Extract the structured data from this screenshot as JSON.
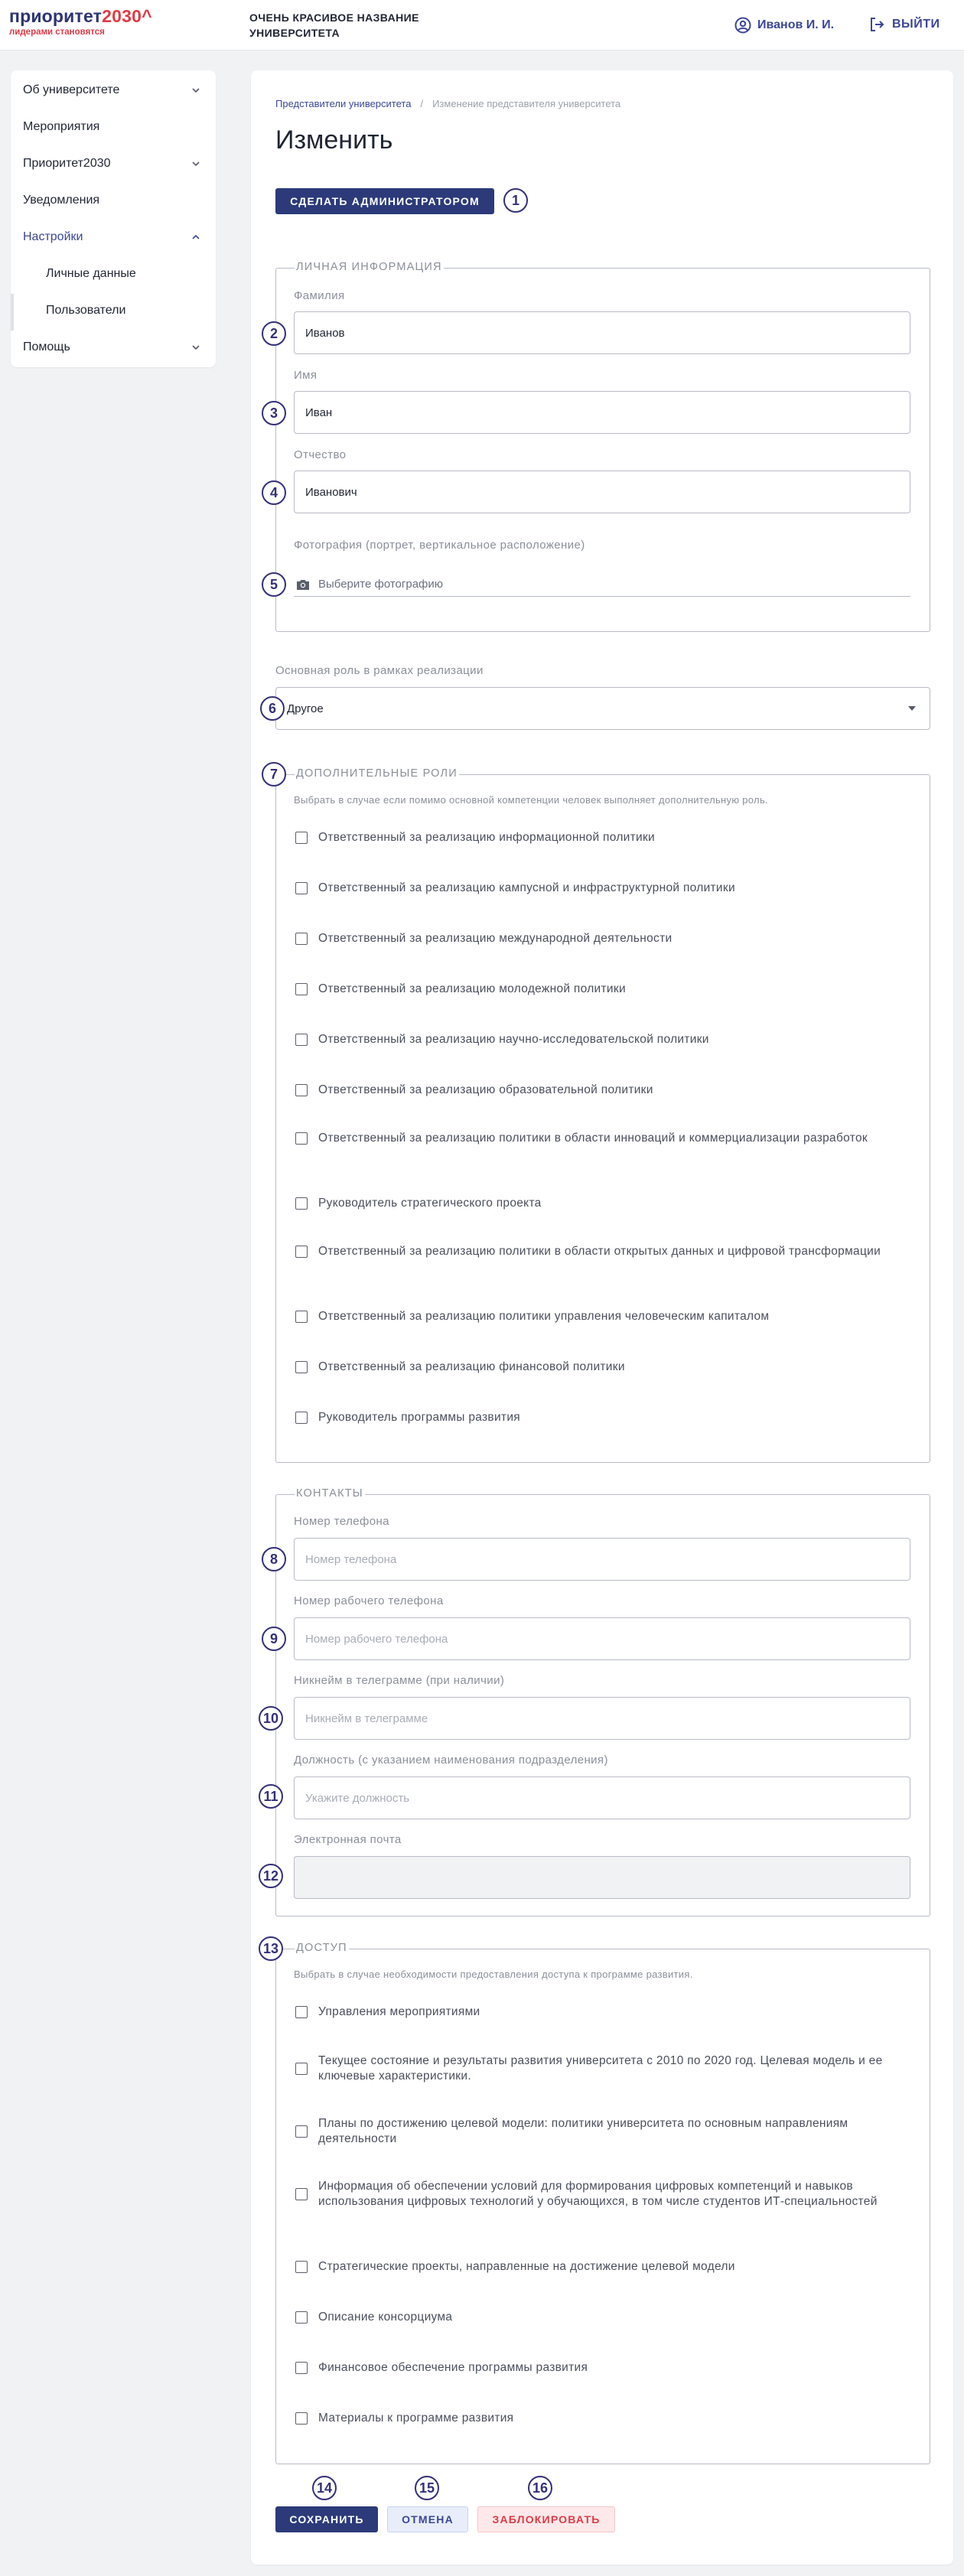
{
  "header": {
    "logo_main": "приоритет",
    "logo_accent": "2030^",
    "logo_sub": "лидерами становятся",
    "university_name": "ОЧЕНЬ КРАСИВОЕ НАЗВАНИЕ УНИВЕРСИТЕТА",
    "user_name": "Иванов И. И.",
    "logout_label": "ВЫЙТИ"
  },
  "sidebar": {
    "items": [
      {
        "label": "Об университете"
      },
      {
        "label": "Мероприятия"
      },
      {
        "label": "Приоритет2030"
      },
      {
        "label": "Уведомления"
      },
      {
        "label": "Настройки"
      },
      {
        "label": "Личные данные"
      },
      {
        "label": "Пользователи"
      },
      {
        "label": "Помощь"
      }
    ]
  },
  "breadcrumb": {
    "parent": "Представители университета",
    "separator": "/",
    "current": "Изменение представителя университета"
  },
  "page_title": "Изменить",
  "make_admin_label": "СДЕЛАТЬ АДМИНИСТРАТОРОМ",
  "markers": [
    "1",
    "2",
    "3",
    "4",
    "5",
    "6",
    "7",
    "8",
    "9",
    "10",
    "11",
    "12",
    "13",
    "14",
    "15",
    "16"
  ],
  "personal": {
    "legend": "ЛИЧНАЯ ИНФОРМАЦИЯ",
    "last_name_label": "Фамилия",
    "last_name_value": "Иванов",
    "first_name_label": "Имя",
    "first_name_value": "Иван",
    "middle_name_label": "Отчество",
    "middle_name_value": "Иванович",
    "photo_label": "Фотография (портрет, вертикальное расположение)",
    "photo_placeholder": "Выберите фотографию"
  },
  "role": {
    "label": "Основная роль в рамках реализации",
    "value": "Другое"
  },
  "additional_roles": {
    "legend": "ДОПОЛНИТЕЛЬНЫЕ РОЛИ",
    "description": "Выбрать в случае если помимо основной компетенции человек выполняет дополнительную роль.",
    "items": [
      {
        "label": "Ответственный за реализацию информационной политики"
      },
      {
        "label": "Ответственный за реализацию кампусной и инфраструктурной политики"
      },
      {
        "label": "Ответственный за реализацию международной деятельности"
      },
      {
        "label": "Ответственный за реализацию молодежной политики"
      },
      {
        "label": "Ответственный за реализацию научно-исследовательской политики"
      },
      {
        "label": "Ответственный за реализацию образовательной политики"
      },
      {
        "label": "Ответственный за реализацию политики в области инноваций и коммерциализации разработок"
      },
      {
        "label": "Руководитель стратегического проекта"
      },
      {
        "label": "Ответственный за реализацию политики в области открытых данных и цифровой трансформации"
      },
      {
        "label": "Ответственный за реализацию политики управления человеческим капиталом"
      },
      {
        "label": "Ответственный за реализацию финансовой политики"
      },
      {
        "label": "Руководитель программы развития"
      }
    ]
  },
  "contacts": {
    "legend": "КОНТАКТЫ",
    "phone_label": "Номер телефона",
    "phone_placeholder": "Номер телефона",
    "work_phone_label": "Номер рабочего телефона",
    "work_phone_placeholder": "Номер рабочего телефона",
    "telegram_label": "Никнейм в телеграмме (при наличии)",
    "telegram_placeholder": "Никнейм в телеграмме",
    "position_label": "Должность (с указанием наименования подразделения)",
    "position_placeholder": "Укажите должность",
    "email_label": "Электронная почта",
    "email_value": ""
  },
  "access": {
    "legend": "ДОСТУП",
    "description": "Выбрать в случае необходимости предоставления доступа к программе развития.",
    "items": [
      {
        "label": "Управления мероприятиями"
      },
      {
        "label": "Текущее состояние и результаты развития университета с 2010 по 2020 год. Целевая модель и ее ключевые характеристики."
      },
      {
        "label": "Планы по достижению целевой модели: политики университета по основным направлениям деятельности"
      },
      {
        "label": "Информация об обеспечении условий для формирования цифровых компетенций и навыков использования цифровых технологий у обучающихся, в том числе студентов ИТ-специальностей"
      },
      {
        "label": "Стратегические проекты, направленные на достижение целевой модели"
      },
      {
        "label": "Описание консорциума"
      },
      {
        "label": "Финансовое обеспечение программы развития"
      },
      {
        "label": "Материалы к программе развития"
      }
    ]
  },
  "actions": {
    "save_label": "СОХРАНИТЬ",
    "cancel_label": "ОТМЕНА",
    "block_label": "ЗАБЛОКИРОВАТЬ"
  },
  "colors": {
    "brand": "#2c3470",
    "accent": "#e03a45",
    "primary_button": "#2c3a7a",
    "marker": "#332f7a"
  }
}
